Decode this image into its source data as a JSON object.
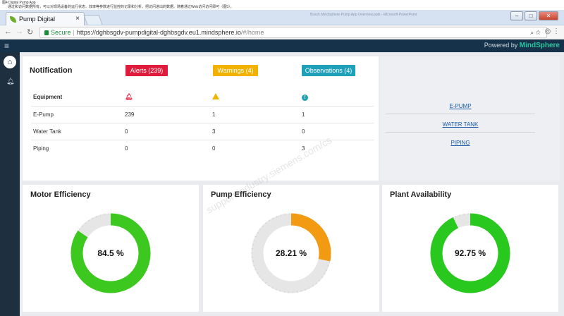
{
  "caption": {
    "line1": "图4 Digital Pump App",
    "line2": "通过和访问数据所有，可以对现场设备的运行状态、效率等参数进行监控的记录和分析，把访问进出的数据。随着通过Web访问访问即可（图5）。"
  },
  "browser": {
    "tab_title": "Pump Digital",
    "tab_close": "×",
    "window_title": "Bosch MindSphere Pump App Overview.pptx - Microsoft PowerPoint",
    "secure_label": "Secure",
    "url_host": "https://dghbsgdv-pumpdigital-dghbsgdv.eu1.mindsphere.io",
    "url_path": "/#/home"
  },
  "appbar": {
    "powered_by": "Powered by",
    "brand": "MindSphere"
  },
  "notification": {
    "title": "Notification",
    "alerts_label": "Alerts (239)",
    "warnings_label": "Warnings (4)",
    "observations_label": "Observations (4)",
    "header": "Equipment",
    "rows": [
      {
        "name": "E-Pump",
        "alerts": "239",
        "warnings": "1",
        "observations": "1"
      },
      {
        "name": "Water Tank",
        "alerts": "0",
        "warnings": "3",
        "observations": "0"
      },
      {
        "name": "Piping",
        "alerts": "0",
        "warnings": "0",
        "observations": "3"
      }
    ]
  },
  "links": [
    "E-PUMP",
    "WATER TANK",
    "PIPING"
  ],
  "efficiency": [
    {
      "title": "Motor Efficiency",
      "value": 84.5,
      "label": "84.5 %",
      "color": "#3cc81e"
    },
    {
      "title": "Pump Efficiency",
      "value": 28.21,
      "label": "28.21 %",
      "color": "#f29a12"
    },
    {
      "title": "Plant Availability",
      "value": 92.75,
      "label": "92.75 %",
      "color": "#28c81e"
    }
  ],
  "colors": {
    "alert": "#e11b3c",
    "warning": "#f3b200",
    "observation": "#1da0b8",
    "track": "#e6e6e6"
  },
  "icons": {
    "home": "home-icon",
    "bell": "bell-icon",
    "menu": "hamburger-menu-icon"
  }
}
